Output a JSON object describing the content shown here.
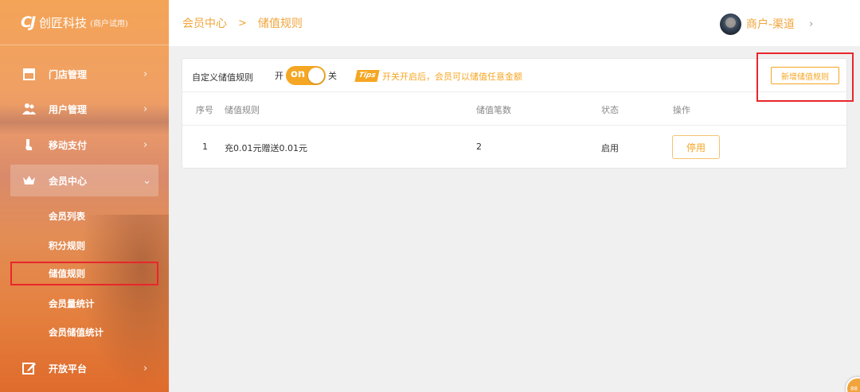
{
  "app": {
    "logo_mark": "CJ",
    "name": "创匠科技",
    "subtitle": "(商户试用)"
  },
  "sidebar": {
    "items": [
      {
        "label": "门店管理",
        "icon": "store-icon",
        "arrow": "›"
      },
      {
        "label": "用户管理",
        "icon": "users-icon",
        "arrow": "›"
      },
      {
        "label": "移动支付",
        "icon": "mobile-pay-icon",
        "arrow": "›"
      },
      {
        "label": "会员中心",
        "icon": "crown-icon",
        "arrow": "⌄",
        "expanded": true
      },
      {
        "label": "开放平台",
        "icon": "edit-icon",
        "arrow": "›"
      }
    ],
    "sub_items": [
      {
        "label": "会员列表"
      },
      {
        "label": "积分规则"
      },
      {
        "label": "储值规则",
        "selected": true
      },
      {
        "label": "会员量统计"
      },
      {
        "label": "会员储值统计"
      }
    ]
  },
  "header": {
    "breadcrumb": [
      "会员中心",
      "储值规则"
    ],
    "separator": ">",
    "user_name": "商户-渠道",
    "user_arrow": "›"
  },
  "toolbar": {
    "label": "自定义储值规则",
    "on_label": "开",
    "toggle_text": "on",
    "toggle_state": true,
    "off_label": "关",
    "tips_badge": "Tips",
    "tips_text": "开关开启后，会员可以储值任意金额",
    "add_button": "新增储值规则"
  },
  "table": {
    "columns": [
      "序号",
      "储值规则",
      "储值笔数",
      "状态",
      "操作"
    ],
    "rows": [
      {
        "index": "1",
        "rule": "充0.01元赠送0.01元",
        "count": "2",
        "status": "启用",
        "action": "停用"
      }
    ]
  },
  "corner_badge": "88",
  "colors": {
    "accent": "#f5a623",
    "highlight_outline": "#e8262b"
  }
}
